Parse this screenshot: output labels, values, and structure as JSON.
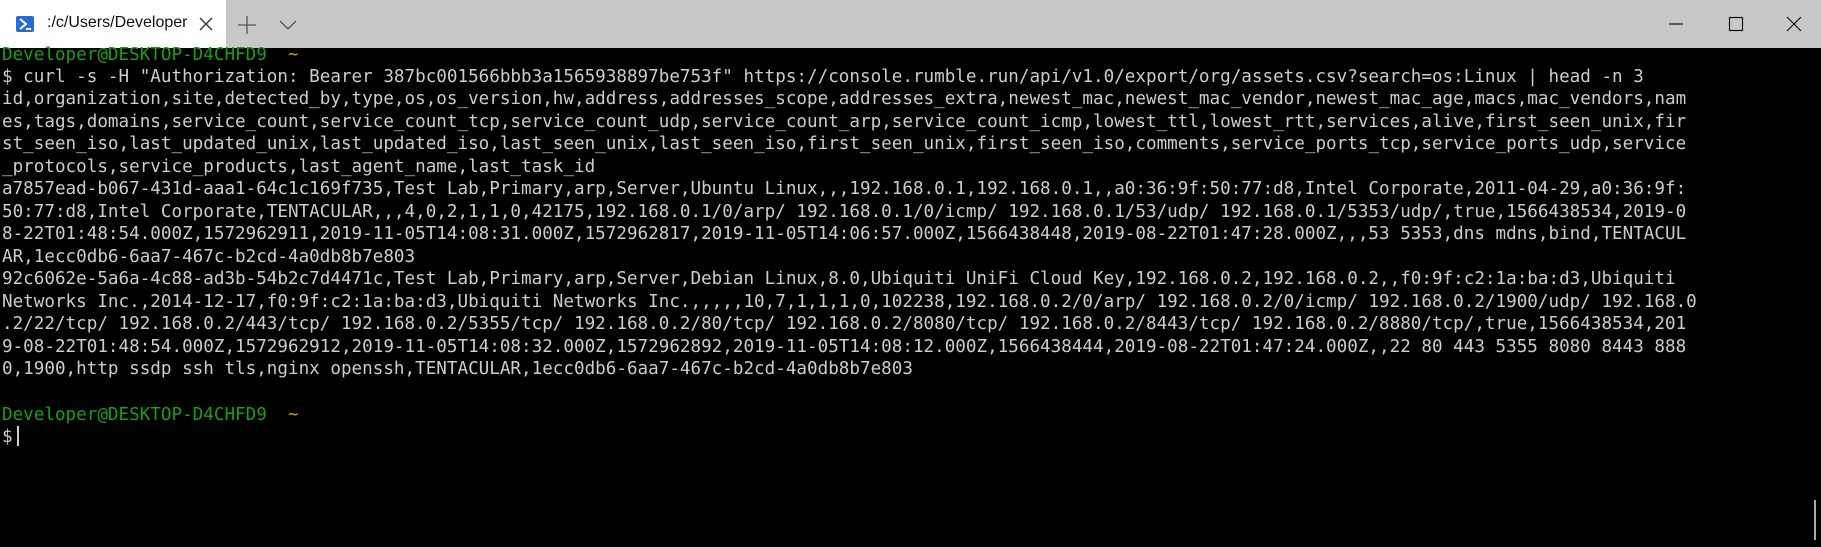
{
  "tab": {
    "title": ":/c/Users/Developer",
    "icon": "powershell-icon",
    "accent": "#2a6bd6"
  },
  "window_controls": {
    "minimize_icon": "minimize-icon",
    "maximize_icon": "maximize-icon",
    "close_icon": "close-icon"
  },
  "terminal": {
    "colors": {
      "prompt": "#13a10e",
      "tilde": "#c19c00",
      "text": "#cccccc",
      "background": "#000000"
    },
    "prompt1": {
      "user_host": "Developer@DESKTOP-D4CHFD9",
      "path": "~"
    },
    "command": "$ curl -s -H \"Authorization: Bearer 387bc001566bbb3a1565938897be753f\" https://console.rumble.run/api/v1.0/export/org/assets.csv?search=os:Linux | head -n 3",
    "output": [
      "id,organization,site,detected_by,type,os,os_version,hw,address,addresses_scope,addresses_extra,newest_mac,newest_mac_vendor,newest_mac_age,macs,mac_vendors,nam",
      "es,tags,domains,service_count,service_count_tcp,service_count_udp,service_count_arp,service_count_icmp,lowest_ttl,lowest_rtt,services,alive,first_seen_unix,fir",
      "st_seen_iso,last_updated_unix,last_updated_iso,last_seen_unix,last_seen_iso,first_seen_unix,first_seen_iso,comments,service_ports_tcp,service_ports_udp,service",
      "_protocols,service_products,last_agent_name,last_task_id",
      "a7857ead-b067-431d-aaa1-64c1c169f735,Test Lab,Primary,arp,Server,Ubuntu Linux,,,192.168.0.1,192.168.0.1,,a0:36:9f:50:77:d8,Intel Corporate,2011-04-29,a0:36:9f:",
      "50:77:d8,Intel Corporate,TENTACULAR,,,4,0,2,1,1,0,42175,192.168.0.1/0/arp/ 192.168.0.1/0/icmp/ 192.168.0.1/53/udp/ 192.168.0.1/5353/udp/,true,1566438534,2019-0",
      "8-22T01:48:54.000Z,1572962911,2019-11-05T14:08:31.000Z,1572962817,2019-11-05T14:06:57.000Z,1566438448,2019-08-22T01:47:28.000Z,,,53 5353,dns mdns,bind,TENTACUL",
      "AR,1ecc0db6-6aa7-467c-b2cd-4a0db8b7e803",
      "92c6062e-5a6a-4c88-ad3b-54b2c7d4471c,Test Lab,Primary,arp,Server,Debian Linux,8.0,Ubiquiti UniFi Cloud Key,192.168.0.2,192.168.0.2,,f0:9f:c2:1a:ba:d3,Ubiquiti",
      "Networks Inc.,2014-12-17,f0:9f:c2:1a:ba:d3,Ubiquiti Networks Inc.,,,,,10,7,1,1,1,0,102238,192.168.0.2/0/arp/ 192.168.0.2/0/icmp/ 192.168.0.2/1900/udp/ 192.168.0",
      ".2/22/tcp/ 192.168.0.2/443/tcp/ 192.168.0.2/5355/tcp/ 192.168.0.2/80/tcp/ 192.168.0.2/8080/tcp/ 192.168.0.2/8443/tcp/ 192.168.0.2/8880/tcp/,true,1566438534,201",
      "9-08-22T01:48:54.000Z,1572962912,2019-11-05T14:08:32.000Z,1572962892,2019-11-05T14:08:12.000Z,1566438444,2019-08-22T01:47:24.000Z,,22 80 443 5355 8080 8443 888",
      "0,1900,http ssdp ssh tls,nginx openssh,TENTACULAR,1ecc0db6-6aa7-467c-b2cd-4a0db8b7e803"
    ],
    "prompt2": {
      "user_host": "Developer@DESKTOP-D4CHFD9",
      "path": "~"
    },
    "input_prompt": "$"
  }
}
